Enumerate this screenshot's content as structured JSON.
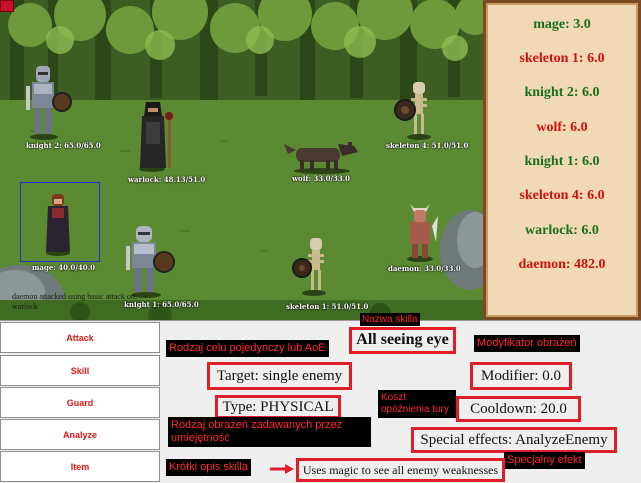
{
  "battlefield": {
    "units": [
      {
        "id": "knight2",
        "label": "knight 2: 65.0/65.0"
      },
      {
        "id": "warlock",
        "label": "warlock: 48.13/51.0"
      },
      {
        "id": "wolf",
        "label": "wolf: 33.0/33.0"
      },
      {
        "id": "skeleton4",
        "label": "skeleton 4: 51.0/51.0"
      },
      {
        "id": "mage",
        "label": "mage: 40.0/40.0"
      },
      {
        "id": "knight1",
        "label": "knight 1: 65.0/65.0"
      },
      {
        "id": "skeleton1",
        "label": "skeleton 1: 51.0/51.0"
      },
      {
        "id": "daemon",
        "label": "daemon: 33.0/33.0"
      }
    ]
  },
  "turn_order": {
    "entries": [
      {
        "text": "mage: 3.0",
        "color": "#1b6e1b"
      },
      {
        "text": "skeleton 1: 6.0",
        "color": "#d01010"
      },
      {
        "text": "knight 2: 6.0",
        "color": "#1b6e1b"
      },
      {
        "text": "wolf: 6.0",
        "color": "#d01010"
      },
      {
        "text": "knight 1: 6.0",
        "color": "#1b6e1b"
      },
      {
        "text": "skeleton 4: 6.0",
        "color": "#d01010"
      },
      {
        "text": "warlock: 6.0",
        "color": "#1b6e1b"
      },
      {
        "text": "daemon: 482.0",
        "color": "#d01010"
      }
    ],
    "log": "daemon attacked using basic attack on: warlock"
  },
  "menu": {
    "attack": "Attack",
    "skill": "Skill",
    "guard": "Guard",
    "analyze": "Analyze",
    "item": "Item"
  },
  "skill_info": {
    "name": "All seeing eye",
    "target": "Target: single enemy",
    "type": "Type: PHYSICAL",
    "modifier": "Modifier: 0.0",
    "cooldown": "Cooldown: 20.0",
    "special": "Special effects: AnalyzeEnemy",
    "description": "Uses magic to see all enemy weaknesses"
  },
  "annotations": {
    "name": "Nazwa skilla",
    "target": "Rodzaj celu pojedynczy lub AoE",
    "modifier": "Modyfikator obrażeń",
    "cooldown": "Koszt opóźnienia tury",
    "type": "Rodzaj obrażeń zadawanych przez umiejętność",
    "special": "Specjalny efekt",
    "description": "Krótki opis skilla"
  },
  "colors": {
    "ally": "#1b6e1b",
    "enemy": "#d01010",
    "highlight": "#e21d2a",
    "selection": "#2b2bd6"
  }
}
